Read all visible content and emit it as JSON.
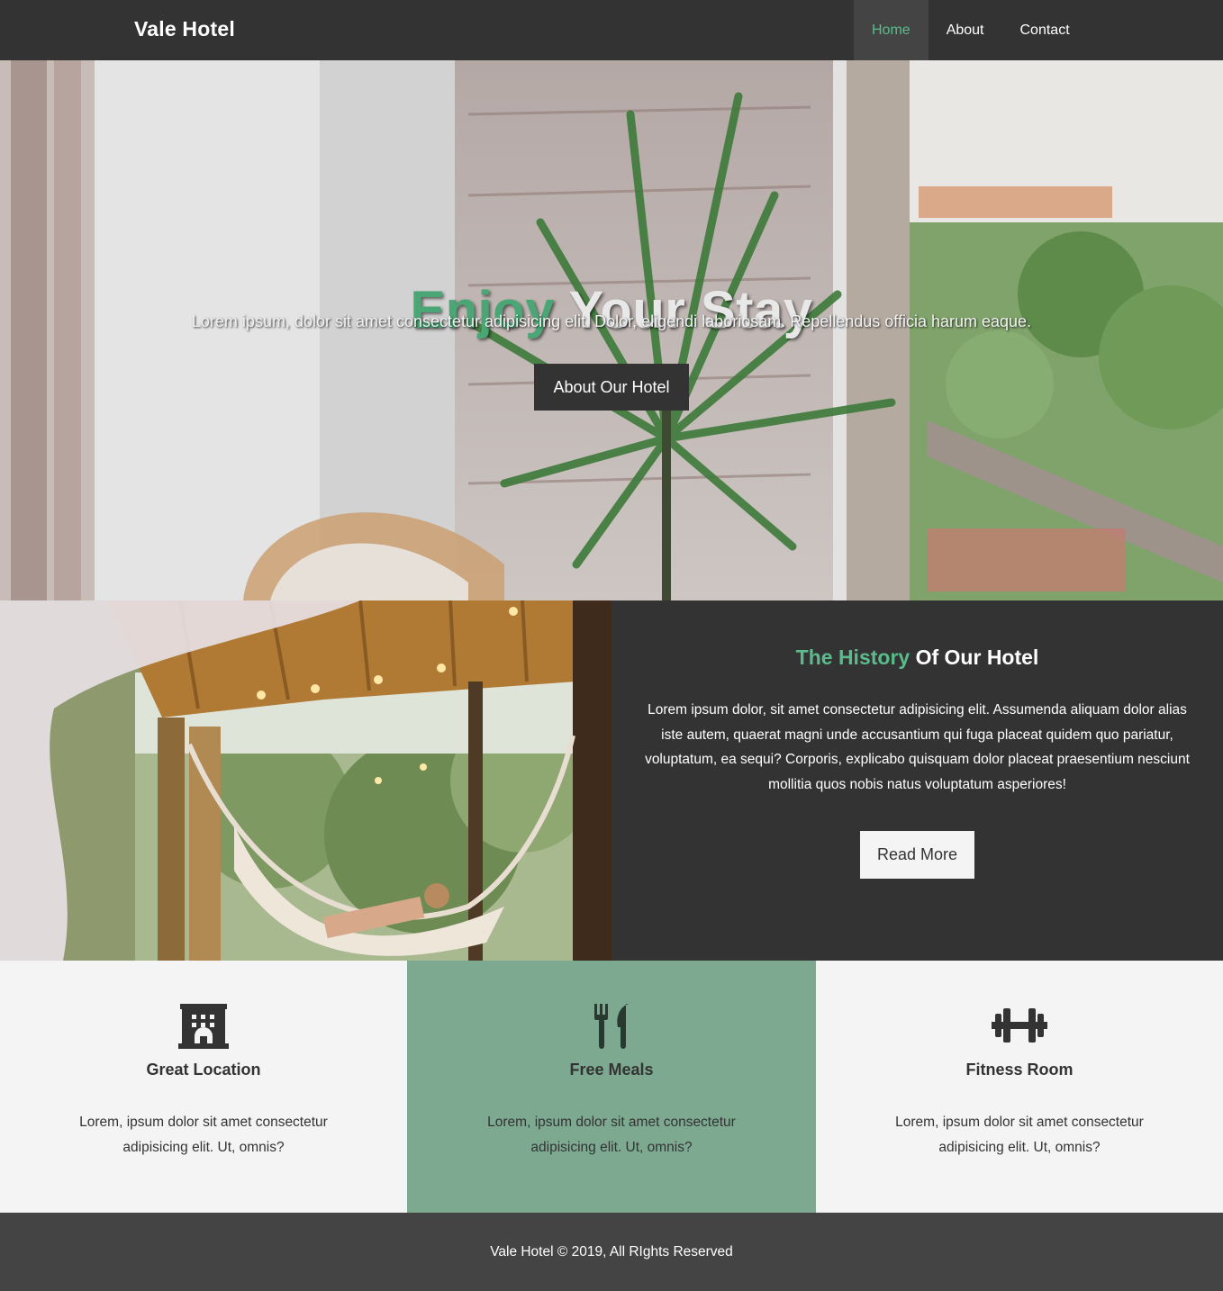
{
  "navbar": {
    "brand": "Vale Hotel",
    "items": [
      {
        "label": "Home",
        "active": true
      },
      {
        "label": "About",
        "active": false
      },
      {
        "label": "Contact",
        "active": false
      }
    ]
  },
  "hero": {
    "title_accent": "Enjoy",
    "title_rest": "Your Stay",
    "subtitle": "Lorem ipsum, dolor sit amet consectetur adipisicing elit. Dolor, eligendi laboriosam. Repellendus officia harum eaque.",
    "button": "About Our Hotel"
  },
  "history": {
    "title_accent": "The History",
    "title_rest": "Of Our Hotel",
    "body": "Lorem ipsum dolor, sit amet consectetur adipisicing elit. Assumenda aliquam dolor alias iste autem, quaerat magni unde accusantium qui fuga placeat quidem quo pariatur, voluptatum, ea sequi? Corporis, explicabo quisquam dolor placeat praesentium nesciunt mollitia quos nobis natus voluptatum asperiores!",
    "button": "Read More"
  },
  "features": [
    {
      "icon": "hotel-icon",
      "title": "Great Location",
      "text": "Lorem, ipsum dolor sit amet consectetur adipisicing elit. Ut, omnis?"
    },
    {
      "icon": "utensils-icon",
      "title": "Free Meals",
      "text": "Lorem, ipsum dolor sit amet consectetur adipisicing elit. Ut, omnis?"
    },
    {
      "icon": "dumbbell-icon",
      "title": "Fitness Room",
      "text": "Lorem, ipsum dolor sit amet consectetur adipisicing elit. Ut, omnis?"
    }
  ],
  "footer": {
    "text": "Vale Hotel © 2019, All RIghts Reserved"
  },
  "colors": {
    "dark": "#333333",
    "accent_green": "#5bbb8c",
    "feature_mid_bg": "#7da991",
    "light_bg": "#f4f4f4",
    "footer_bg": "#444444"
  }
}
